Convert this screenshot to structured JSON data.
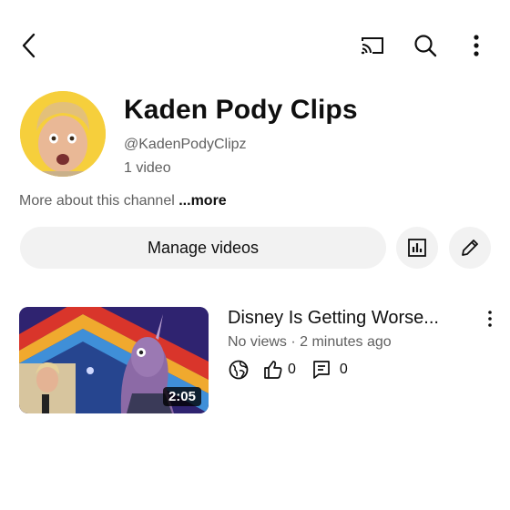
{
  "topbar": {
    "back_icon": "arrow-left-icon",
    "cast_icon": "cast-icon",
    "search_icon": "search-icon",
    "menu_icon": "more-vertical-icon"
  },
  "channel": {
    "name": "Kaden Pody Clips",
    "handle": "@KadenPodyClipz",
    "video_count": "1 video",
    "about_text": "More about this channel",
    "about_more": "...more"
  },
  "actions": {
    "manage_label": "Manage videos",
    "analytics_icon": "analytics-icon",
    "edit_icon": "pencil-icon"
  },
  "videos": [
    {
      "title": "Disney Is Getting Worse...",
      "meta": "No views · 2 minutes ago",
      "duration": "2:05",
      "visibility_icon": "globe-icon",
      "likes": "0",
      "comments": "0"
    }
  ],
  "colors": {
    "text": "#0f0f0f",
    "secondary": "#606060",
    "chip_bg": "#f2f2f2"
  }
}
